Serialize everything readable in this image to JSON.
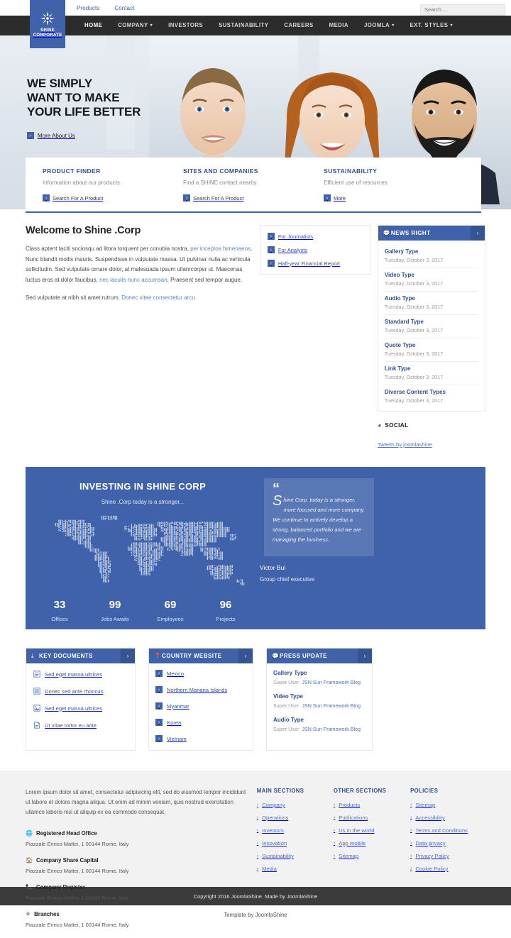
{
  "topbar": {
    "links": [
      {
        "label": "Products"
      },
      {
        "label": "Contact"
      }
    ],
    "search_placeholder": "Search ...",
    "search_value": ""
  },
  "logo": {
    "line1": "SHINE",
    "line2": "CORPORATE",
    "icon": "starburst-icon",
    "background": "#3f62ab"
  },
  "nav": {
    "items": [
      {
        "label": "HOME",
        "active": true,
        "caret": false
      },
      {
        "label": "COMPANY",
        "active": false,
        "caret": true
      },
      {
        "label": "INVESTORS",
        "active": false,
        "caret": false
      },
      {
        "label": "SUSTAINABILITY",
        "active": false,
        "caret": false
      },
      {
        "label": "CAREERS",
        "active": false,
        "caret": false
      },
      {
        "label": "MEDIA",
        "active": false,
        "caret": false
      },
      {
        "label": "JOOMLA",
        "active": false,
        "caret": true
      },
      {
        "label": "EXT. STYLES",
        "active": false,
        "caret": true
      }
    ],
    "background": "#2c2c2c"
  },
  "hero": {
    "line1": "WE SIMPLY",
    "line2": "WANT TO MAKE",
    "line3": "YOUR LIFE BETTER",
    "cta": "More About Us"
  },
  "features": [
    {
      "title": "PRODUCT FINDER",
      "desc": "Information about our products.",
      "link": "Search For A Product"
    },
    {
      "title": "SITES AND COMPANIES",
      "desc": "Find a SHINE contact nearby.",
      "link": "Search For A Product"
    },
    {
      "title": "SUSTAINABILITY",
      "desc": "Efficient use of resources.",
      "link": "More"
    }
  ],
  "welcome": {
    "heading": "Welcome to Shine .Corp",
    "p1_a": "Class aptent taciti sociosqu ad litora torquent per conubia nostra, ",
    "p1_link1": "per inceptos himenaeos",
    "p1_b": ". Nunc blandit mollis mauris. Suspendisse in vulputate massa. Ut pulvinar nulla ac vehicula sollicitudin. Sed vulputate ornare dolor, at malesuada ipsum ullamcorper ut. Maecenas luctus eros at dolor faucibus, ",
    "p1_link2": "nec iaculis nunc accumsan",
    "p1_c": ". Praesent sed tempor augue.",
    "p2_a": "Sed vulputate at nibh sit amet rutrum. ",
    "p2_link": "Donec vitae consectetur arcu."
  },
  "quicklinks": [
    {
      "label": "For Journalists"
    },
    {
      "label": "For Analysts"
    },
    {
      "label": "Half-year Financial Report"
    }
  ],
  "news_module": {
    "title": "NEWS RIGHT",
    "icon": "comment-icon",
    "arrow": "›",
    "items": [
      {
        "title": "Gallery Type",
        "date": "Tuesday, October 3, 2017"
      },
      {
        "title": "Video Type",
        "date": "Tuesday, October 3, 2017"
      },
      {
        "title": "Audio Type",
        "date": "Tuesday, October 3, 2017"
      },
      {
        "title": "Standard Type",
        "date": "Tuesday, October 3, 2017"
      },
      {
        "title": "Quote Type",
        "date": "Tuesday, October 3, 2017"
      },
      {
        "title": "Link Type",
        "date": "Tuesday, October 3, 2017"
      },
      {
        "title": "Diverse Content Types",
        "date": "Tuesday, October 3, 2017"
      }
    ]
  },
  "social": {
    "title": "SOCIAL",
    "icon": "twitter-bird-icon",
    "tweets_label": "Tweets by joomlashine"
  },
  "invest": {
    "title": "INVESTING IN SHINE CORP",
    "subtitle": "Shine .Corp today is a stronger...",
    "quote_dropcap": "S",
    "quote_text": "hine Corp. today is a stronger, more focused and more company. We continue to actively develop a strong, balanced portfolio and we are managing the business.",
    "author_name": "Victor Bui",
    "author_role": "Group chief executive",
    "background": "#3f62ab"
  },
  "chart_data": {
    "type": "bar",
    "title": "INVESTING IN SHINE CORP",
    "categories": [
      "Offices",
      "Jobs Awaits",
      "Employees",
      "Projects"
    ],
    "values": [
      33,
      99,
      69,
      96
    ],
    "xlabel": "",
    "ylabel": "",
    "ylim": [
      0,
      100
    ],
    "grid": false,
    "legend": "none",
    "note": "Counter statistics displayed as large numbers with labels."
  },
  "widgets": {
    "key_documents": {
      "title": "KEY DOCUMENTS",
      "icon": "download-icon",
      "arrow": "›",
      "items": [
        {
          "label": "Sed eget massa ultrices",
          "icon": "doc-text-icon"
        },
        {
          "label": "Donec sed ante rhoncus",
          "icon": "doc-grid-icon"
        },
        {
          "label": "Sed eget massa ultrices",
          "icon": "doc-image-icon"
        },
        {
          "label": "Ut vitae tortor eu ante",
          "icon": "doc-pdf-icon"
        }
      ]
    },
    "country_website": {
      "title": "COUNTRY WEBSITE",
      "icon": "map-pin-icon",
      "arrow": "›",
      "items": [
        {
          "label": "Mexico"
        },
        {
          "label": "Northern Mariana Islands"
        },
        {
          "label": "Myanmar"
        },
        {
          "label": "Korea"
        },
        {
          "label": "Vietnam"
        }
      ]
    },
    "press_update": {
      "title": "PRESS UPDATE",
      "icon": "comment-icon",
      "arrow": "›",
      "items": [
        {
          "title": "Gallery Type",
          "author": "Super User",
          "blog": "JSN Sun Framework Blog"
        },
        {
          "title": "Video Type",
          "author": "Super User",
          "blog": "JSN Sun Framework Blog"
        },
        {
          "title": "Audio Type",
          "author": "Super User",
          "blog": "JSN Sun Framework Blog"
        }
      ]
    }
  },
  "footer": {
    "lorem": "Lorem ipsum dolor sit amet, consectetur adipisicing elit, sed do eiusmod tempor incididunt ut labore et dolore magna aliqua. Ut enim ad minim veniam, quis nostrud exercitation ullamco laboris nisi ut aliquip ex ea commodo consequat.",
    "addresses": [
      {
        "label": "Registered Head Office",
        "icon": "globe-icon",
        "value": "Piazzale Enrico Mattei, 1 00144 Rome, Italy"
      },
      {
        "label": "Company Share Capital",
        "icon": "home-icon",
        "value": "Piazzale Enrico Mattei, 1 00144 Rome, Italy"
      },
      {
        "label": "Company Register",
        "icon": "phone-icon",
        "value": "Piazzale Enrico Mattei, 1 00144 Rome, Italy"
      },
      {
        "label": "Branches",
        "icon": "branches-icon",
        "value": "Piazzale Enrico Mattei, 1 00144 Rome, Italy"
      }
    ],
    "columns": [
      {
        "title": "MAIN SECTIONS",
        "links": [
          "Company",
          "Operations",
          "Investors",
          "Innovation",
          "Sustainability",
          "Media"
        ]
      },
      {
        "title": "OTHER SECTIONS",
        "links": [
          "Products",
          "Publications",
          "Us in the world",
          "App mobile",
          "Sitemap"
        ]
      },
      {
        "title": "POLICIES",
        "links": [
          "Sitemap",
          "Accessibility",
          "Terms and Conditions",
          "Data privacy",
          "Privacy Policy",
          "Cookie Policy"
        ]
      }
    ],
    "copyright": "Copyright 2016 JoomlaShine. Made by JoomlaShine",
    "template_by": "Template by JoomlaShine"
  }
}
